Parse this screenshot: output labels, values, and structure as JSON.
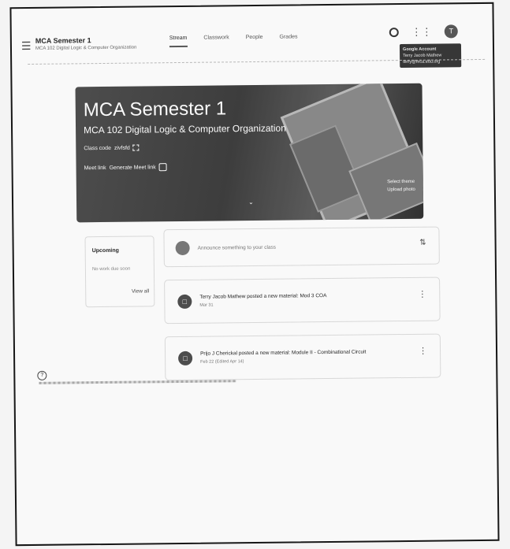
{
  "header": {
    "class_name": "MCA Semester 1",
    "class_subtitle": "MCA 102 Digital Logic & Computer Organization",
    "tabs": [
      "Stream",
      "Classwork",
      "People",
      "Grades"
    ],
    "active_tab": "Stream",
    "avatar_letter": "T",
    "account_tooltip": {
      "title": "Google Account",
      "name": "Terry Jacob Mathew",
      "email": "terry@mca.edu.org"
    }
  },
  "banner": {
    "title": "MCA Semester 1",
    "subtitle": "MCA 102 Digital Logic & Computer Organization",
    "class_code_label": "Class code",
    "class_code": "zivfsfd",
    "meet_label": "Meet link",
    "meet_value": "Generate Meet link",
    "select_theme": "Select theme",
    "upload_photo": "Upload photo"
  },
  "upcoming": {
    "title": "Upcoming",
    "text": "No work due soon",
    "view_all": "View all"
  },
  "announce": {
    "placeholder": "Announce something to your class"
  },
  "posts": [
    {
      "title": "Terry Jacob Mathew posted a new material: Mod 3 COA",
      "date": "Mar 31"
    },
    {
      "title": "Prijo J Cherickal posted a new material: Module II - Combinational Circuit",
      "date": "Feb 22 (Edited Apr 14)"
    }
  ]
}
